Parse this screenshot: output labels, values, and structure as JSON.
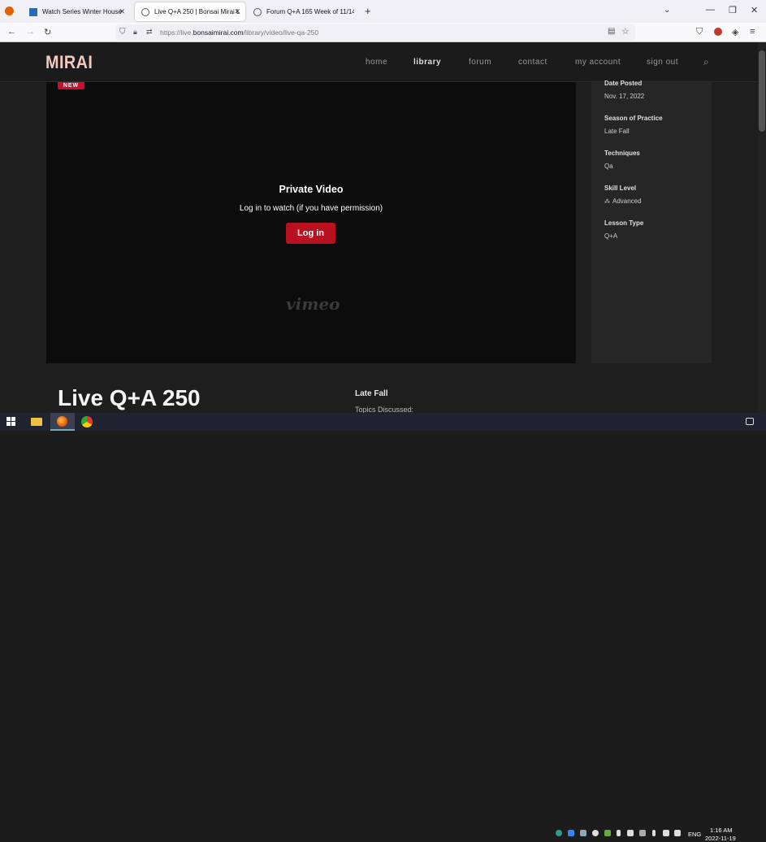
{
  "browser": {
    "tabs": [
      {
        "title": "Watch Series Winter House Sea",
        "active": false
      },
      {
        "title": "Live Q+A 250 | Bonsai Mirai Live",
        "active": true
      },
      {
        "title": "Forum Q+A 165 Week of 11/14",
        "active": false
      }
    ],
    "url_prefix": "https://live.",
    "url_domain": "bonsaimirai.com",
    "url_path": "/library/video/live-qa-250"
  },
  "site": {
    "logo": "MIRAI",
    "menu": [
      "home",
      "library",
      "forum",
      "contact",
      "my account",
      "sign out"
    ],
    "current_menu": "library"
  },
  "video": {
    "badge": "NEW",
    "title": "Private Video",
    "subtitle": "Log in to watch (if you have permission)",
    "login_label": "Log in",
    "watermark": "vimeo"
  },
  "details": [
    {
      "label": "Date Posted",
      "value": "Nov. 17, 2022"
    },
    {
      "label": "Season of Practice",
      "value": "Late Fall"
    },
    {
      "label": "Techniques",
      "value": "Qa"
    },
    {
      "label": "Skill Level",
      "value": "Advanced"
    },
    {
      "label": "Lesson Type",
      "value": "Q+A"
    }
  ],
  "page": {
    "title": "Live Q+A 250",
    "season": "Late Fall",
    "topics": "Topics Discussed:"
  },
  "taskbar": {
    "time": "1:16 AM",
    "date": "2022-11-19",
    "lang": "ENG"
  },
  "colors": {
    "accent": "#b8101f",
    "logo": "#f2c9c0",
    "background": "#1e1e1e"
  }
}
